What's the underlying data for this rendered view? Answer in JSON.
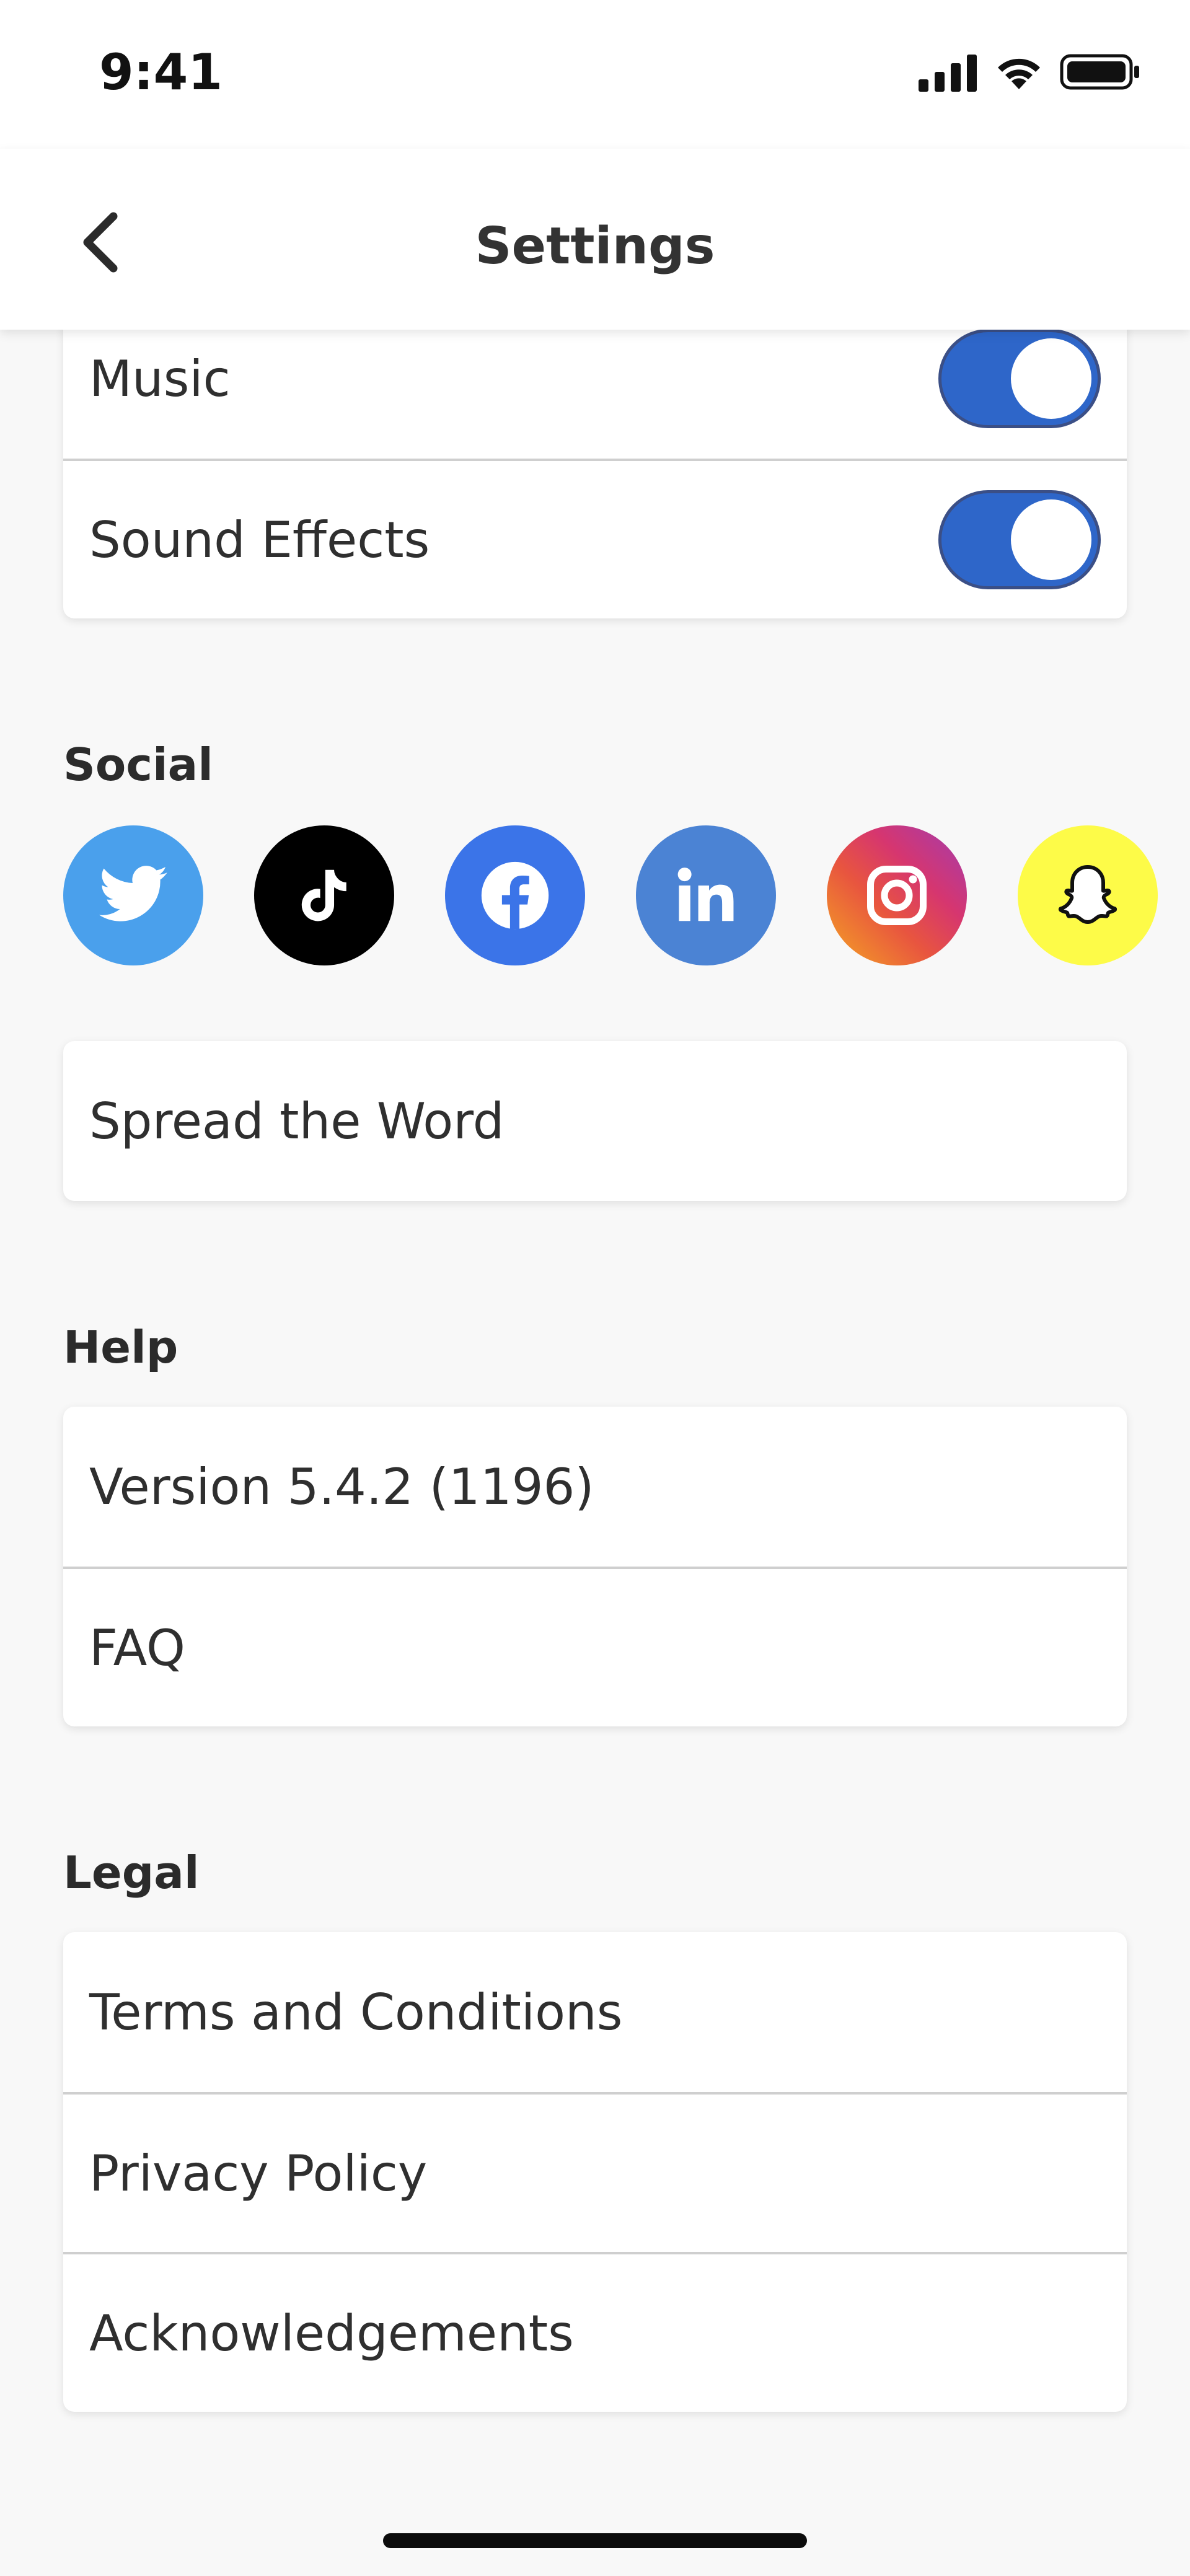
{
  "status_bar": {
    "time": "9:41"
  },
  "nav": {
    "title": "Settings"
  },
  "sound": {
    "items": [
      {
        "label": "Music",
        "enabled": true
      },
      {
        "label": "Sound Effects",
        "enabled": true
      }
    ]
  },
  "social": {
    "title": "Social",
    "icons": [
      {
        "name": "twitter-icon",
        "color": "#4aa0ec"
      },
      {
        "name": "tiktok-icon",
        "color": "#000000"
      },
      {
        "name": "facebook-icon",
        "color": "#3b74e8"
      },
      {
        "name": "linkedin-icon",
        "color": "#4b83d4"
      },
      {
        "name": "instagram-icon",
        "color": "#d6366f"
      },
      {
        "name": "snapchat-icon",
        "color": "#fdfb48"
      }
    ],
    "spread_label": "Spread the Word"
  },
  "help": {
    "title": "Help",
    "items": [
      {
        "label": "Version 5.4.2 (1196)"
      },
      {
        "label": "FAQ"
      }
    ]
  },
  "legal": {
    "title": "Legal",
    "items": [
      {
        "label": "Terms and Conditions"
      },
      {
        "label": "Privacy Policy"
      },
      {
        "label": "Acknowledgements"
      }
    ]
  },
  "colors": {
    "toggle_on": "#2e66c9",
    "background": "#f8f8f8"
  }
}
